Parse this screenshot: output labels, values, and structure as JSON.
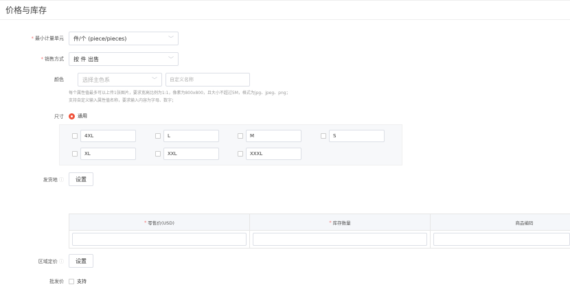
{
  "title": "价格与库存",
  "min_unit": {
    "label": "最小计量单元",
    "value": "件/个 (piece/pieces)"
  },
  "sale_mode": {
    "label": "销售方式",
    "value": "按 件 出售"
  },
  "color": {
    "label": "颜色",
    "select_placeholder": "选择主色系",
    "input_placeholder": "自定义名称",
    "hint1": "每个属性值最多可以上传1张图片，要求宽高比例为1:1，像素为800x800，且大小不超过5M，格式为jpg、jpeg、png；",
    "hint2": "支持自定义输入属性值名称，要求输入内容为字母、数字；"
  },
  "size": {
    "label": "尺寸",
    "radio_label": "通用",
    "options": [
      "4XL",
      "L",
      "M",
      "S",
      "XL",
      "XXL",
      "XXXL"
    ]
  },
  "ship_from": {
    "label": "发货地",
    "button": "设置"
  },
  "table": {
    "headers": [
      "零售价(USD)",
      "库存数量",
      "商品编码"
    ],
    "required": [
      true,
      true,
      false
    ]
  },
  "region_price": {
    "label": "区域定价",
    "button": "设置"
  },
  "wholesale": {
    "label": "批发价",
    "checkbox_label": "支持"
  }
}
